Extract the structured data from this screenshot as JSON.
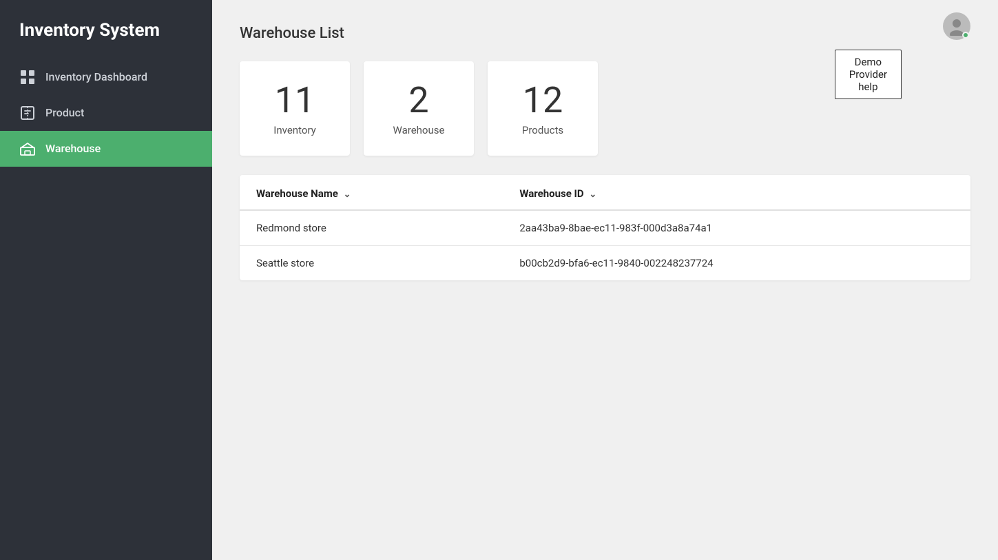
{
  "app": {
    "title": "Inventory System"
  },
  "sidebar": {
    "items": [
      {
        "id": "inventory-dashboard",
        "label": "Inventory Dashboard",
        "icon": "dashboard-icon",
        "active": false
      },
      {
        "id": "product",
        "label": "Product",
        "icon": "product-icon",
        "active": false
      },
      {
        "id": "warehouse",
        "label": "Warehouse",
        "icon": "warehouse-icon",
        "active": true
      }
    ]
  },
  "header": {
    "demo_help_label": "Demo Provider help",
    "page_title": "Warehouse List"
  },
  "stats": [
    {
      "id": "inventory-stat",
      "number": "11",
      "label": "Inventory"
    },
    {
      "id": "warehouse-stat",
      "number": "2",
      "label": "Warehouse"
    },
    {
      "id": "products-stat",
      "number": "12",
      "label": "Products"
    }
  ],
  "table": {
    "columns": [
      {
        "id": "name",
        "label": "Warehouse Name",
        "sortable": true
      },
      {
        "id": "id",
        "label": "Warehouse ID",
        "sortable": true
      }
    ],
    "rows": [
      {
        "name": "Redmond store",
        "warehouse_id": "2aa43ba9-8bae-ec11-983f-000d3a8a74a1"
      },
      {
        "name": "Seattle store",
        "warehouse_id": "b00cb2d9-bfa6-ec11-9840-002248237724"
      }
    ]
  }
}
